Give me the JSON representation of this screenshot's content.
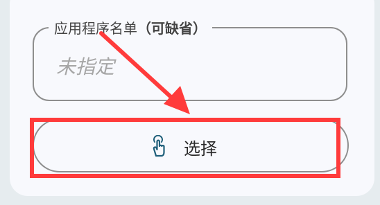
{
  "field": {
    "label_main": "应用程序名单",
    "label_paren": "（可缺省）",
    "placeholder": "未指定"
  },
  "select_button": {
    "label": "选择",
    "icon": "touch-icon"
  },
  "annotation": {
    "color": "#ff3b3b"
  }
}
